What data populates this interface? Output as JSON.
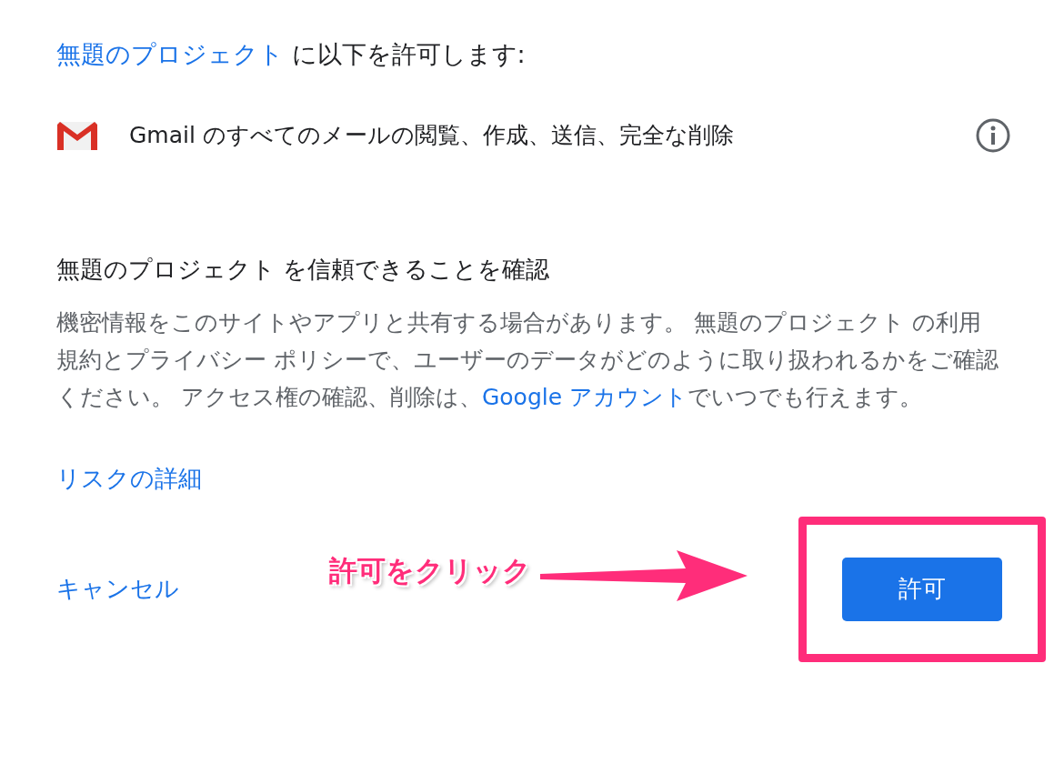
{
  "consent": {
    "app_name": "無題のプロジェクト",
    "title_rest": " に以下を許可します:",
    "permissions": [
      {
        "text": "Gmail のすべてのメールの閲覧、作成、送信、完全な削除"
      }
    ],
    "trust_heading": "無題のプロジェクト を信頼できることを確認",
    "paragraph": {
      "before": "機密情報をこのサイトやアプリと共有する場合があります。 無題のプロジェクト の利用規約とプライバシー ポリシーで、ユーザーのデータがどのように取り扱われるかをご確認ください。 アクセス権の確認、削除は、",
      "link": "Google アカウント",
      "after": "でいつでも行えます。"
    },
    "risk_link": "リスクの詳細",
    "cancel": "キャンセル",
    "allow": "許可"
  },
  "annotation": {
    "text": "許可をクリック"
  }
}
